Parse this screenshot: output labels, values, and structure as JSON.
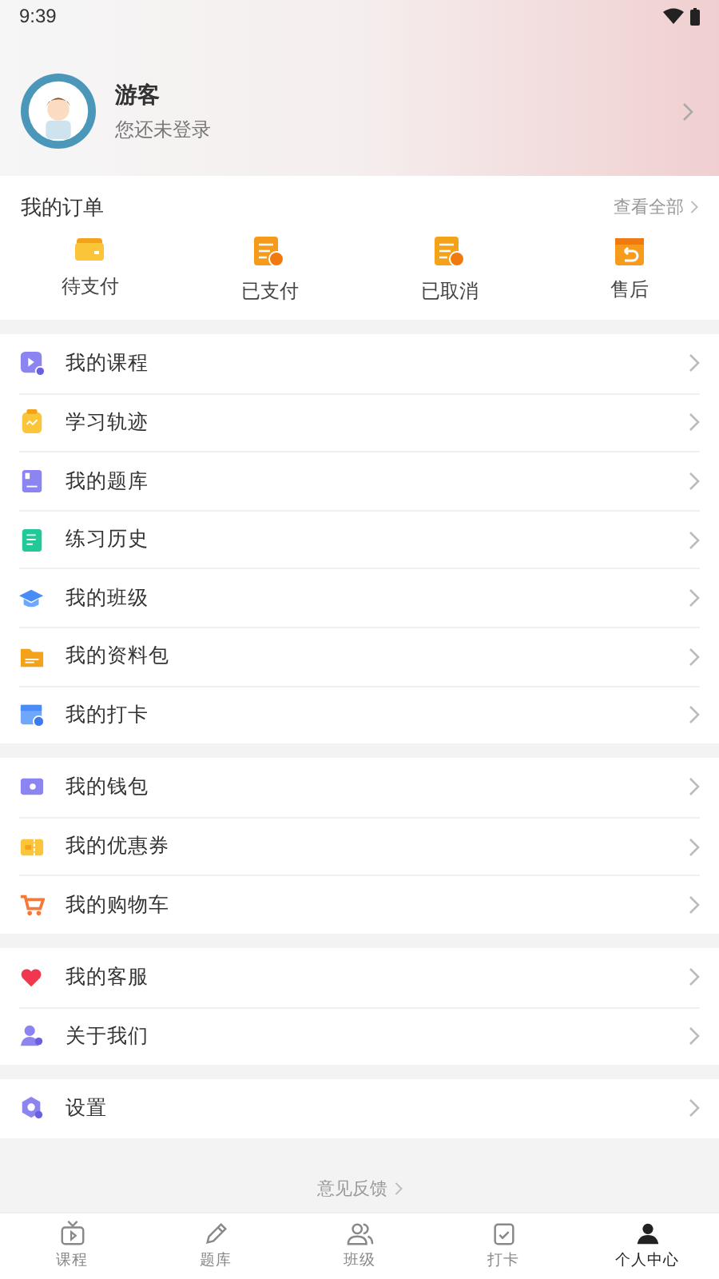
{
  "status_bar": {
    "time": "9:39"
  },
  "profile": {
    "name": "游客",
    "subtitle": "您还未登录"
  },
  "orders": {
    "title": "我的订单",
    "view_all": "查看全部",
    "items": [
      {
        "label": "待支付"
      },
      {
        "label": "已支付"
      },
      {
        "label": "已取消"
      },
      {
        "label": "售后"
      }
    ]
  },
  "menu_groups": [
    {
      "items": [
        {
          "label": "我的课程"
        },
        {
          "label": "学习轨迹"
        },
        {
          "label": "我的题库"
        },
        {
          "label": "练习历史"
        },
        {
          "label": "我的班级"
        },
        {
          "label": "我的资料包"
        },
        {
          "label": "我的打卡"
        }
      ]
    },
    {
      "items": [
        {
          "label": "我的钱包"
        },
        {
          "label": "我的优惠券"
        },
        {
          "label": "我的购物车"
        }
      ]
    },
    {
      "items": [
        {
          "label": "我的客服"
        },
        {
          "label": "关于我们"
        }
      ]
    },
    {
      "items": [
        {
          "label": "设置"
        }
      ]
    }
  ],
  "feedback": "意见反馈",
  "tab_bar": [
    {
      "label": "课程",
      "selected": false
    },
    {
      "label": "题库",
      "selected": false
    },
    {
      "label": "班级",
      "selected": false
    },
    {
      "label": "打卡",
      "selected": false
    },
    {
      "label": "个人中心",
      "selected": true
    }
  ]
}
